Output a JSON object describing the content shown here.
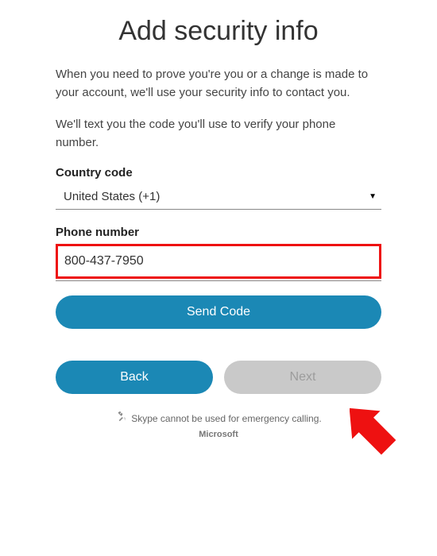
{
  "title": "Add security info",
  "intro1": "When you need to prove you're you or a change is made to your account, we'll use your security info to contact you.",
  "intro2": "We'll text you the code you'll use to verify your phone number.",
  "countryCode": {
    "label": "Country code",
    "selected": "United States (+1)"
  },
  "phone": {
    "label": "Phone number",
    "value": "800-437-7950"
  },
  "buttons": {
    "sendCode": "Send Code",
    "back": "Back",
    "next": "Next"
  },
  "footer": {
    "emergency": "Skype cannot be used for emergency calling.",
    "brand": "Microsoft"
  },
  "annotation": {
    "arrow": "red-arrow-pointing-to-send-code",
    "highlight": "red-box-around-phone-input"
  }
}
